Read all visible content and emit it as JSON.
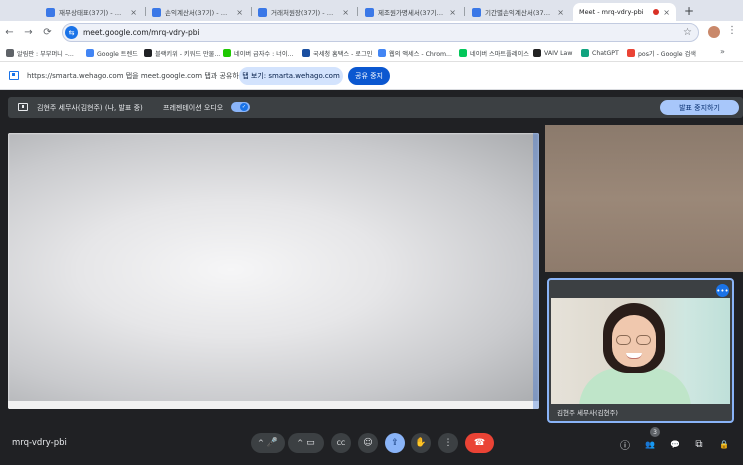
{
  "browser": {
    "tabs": [
      {
        "label": "재무상태표(37기) - 주식회사",
        "active": false
      },
      {
        "label": "손익계산서(37기) - 주식회사",
        "active": false
      },
      {
        "label": "거래처원장(37기) - 주식회사",
        "active": false
      },
      {
        "label": "제조원가명세서(37기) - 주식",
        "active": false
      },
      {
        "label": "기간별손익계산서(37기) - 주",
        "active": false
      },
      {
        "label": "Meet - mrq-vdry-pbi",
        "active": true
      }
    ],
    "new_tab_glyph": "+",
    "url": "meet.google.com/mrq-vdry-pbi",
    "bookmarks": [
      {
        "label": "알림판 : 부부머니 –...",
        "color": "#5f6368"
      },
      {
        "label": "Google 트렌드",
        "color": "#4285f4"
      },
      {
        "label": "블랙키위 - 키워드 만물...",
        "color": "#202124"
      },
      {
        "label": "네이버 급자수 : 너이...",
        "color": "#1ec800"
      },
      {
        "label": "국세청 홈택스 - 로그인",
        "color": "#1a4fa0"
      },
      {
        "label": "웹의 액세스 - Chrom...",
        "color": "#4285f4"
      },
      {
        "label": "네이버 스마트플레이스",
        "color": "#03c75a"
      },
      {
        "label": "VAIV Law",
        "color": "#222222"
      },
      {
        "label": "ChatGPT",
        "color": "#10a37f"
      },
      {
        "label": "pos기 - Google 검색",
        "color": "#ea4335"
      }
    ],
    "bookmarks_more": "»"
  },
  "share_bar": {
    "message": "https://smarta.wehago.com 탭을 meet.google.com 탭과 공유하는 중",
    "switch_label": "탭 보기: smarta.wehago.com",
    "stop_label": "공유 중지"
  },
  "meet": {
    "presenting_text": "김현주 세무사(김현주) (나, 발표 중)",
    "audio_text": "프레젠테이션 오디오",
    "stop_presenting_label": "발표 중지하기",
    "self_name": "김현주 세무사(김현주)",
    "meeting_code": "mrq-vdry-pbi",
    "participant_count": "3",
    "colors": {
      "accent": "#8ab4f8",
      "end_call": "#ea4335",
      "background": "#202124"
    }
  },
  "icons": {
    "back": "←",
    "forward": "→",
    "reload": "⟳",
    "star": "☆",
    "menu": "⋮",
    "mic": "🎤",
    "camera": "▭",
    "captions": "CC",
    "emoji": "☺",
    "present": "⇪",
    "hand": "✋",
    "more": "⋮",
    "end": "☎",
    "info": "ⓘ",
    "people": "👥",
    "chat": "💬",
    "activities": "⧉",
    "lock": "🔒",
    "chevron_up": "^"
  }
}
